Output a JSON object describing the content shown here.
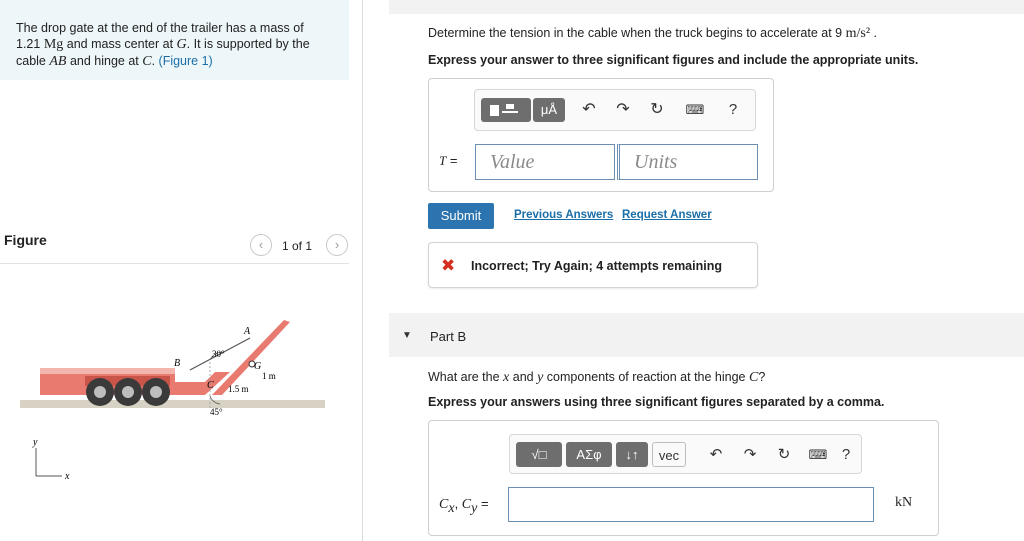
{
  "problem": {
    "text_1": "The drop gate at the end of the trailer has a mass of",
    "mass_value": "1.21",
    "mass_unit": "Mg",
    "text_2": " and mass center at ",
    "point_g": "G",
    "text_3": ". It is supported by the",
    "text_4": "cable ",
    "cable": "AB",
    "text_5": " and hinge at ",
    "point_c": "C",
    "text_6": ". ",
    "figure_link": "(Figure 1)"
  },
  "figure": {
    "heading": "Figure",
    "pager": "1 of 1",
    "prev_icon": "chevron-left-icon",
    "next_icon": "chevron-right-icon",
    "labels": {
      "a": "A",
      "b": "B",
      "c": "C",
      "g": "G",
      "angle_30": "30°",
      "angle_45": "45°",
      "len_1m": "1 m",
      "len_15m": "1.5 m",
      "axis_y": "y",
      "axis_x": "x"
    },
    "colors": {
      "trailer": "#e87a70",
      "trailer_light": "#f2b6ae",
      "ground": "#d8d2c4",
      "wheel": "#3a3a3a"
    }
  },
  "part_a": {
    "question_prefix": "Determine the tension in the cable when the truck begins to accelerate at 9 ",
    "accel_unit": "m/s²",
    "question_suffix": " .",
    "instruction": "Express your answer to three significant figures and include the appropriate units.",
    "toolbar": {
      "templates_icon": "templates-icon",
      "units_label": "μÅ",
      "undo_icon": "undo-icon",
      "redo_icon": "redo-icon",
      "reset_icon": "reset-icon",
      "keyboard_icon": "keyboard-icon",
      "help_label": "?"
    },
    "eq_label": "T",
    "eq_sign": " =",
    "value_placeholder": "Value",
    "units_placeholder": "Units",
    "submit_label": "Submit",
    "previous_answers": "Previous Answers",
    "request_answer": "Request Answer",
    "feedback_icon": "✖",
    "feedback": "Incorrect; Try Again; 4 attempts remaining",
    "feedback_color": "#d62e1f"
  },
  "part_b": {
    "caret": "▼",
    "title": "Part B",
    "question_1": "What are the ",
    "var_x": "x",
    "question_2": " and ",
    "var_y": "y",
    "question_3": " components of reaction at the hinge ",
    "hinge": "C",
    "question_4": "?",
    "instruction": "Express your answers using three significant figures separated by a comma.",
    "toolbar": {
      "matrix_label": "√□",
      "greek_label": "ΑΣφ",
      "arrows_label": "↓↑",
      "vec_label": "vec",
      "undo_icon": "undo-icon",
      "redo_icon": "redo-icon",
      "reset_icon": "reset-icon",
      "keyboard_icon": "keyboard-icon",
      "help_label": "?"
    },
    "eq_cx": "C",
    "eq_cx_sub": "x",
    "eq_sep": ", ",
    "eq_cy": "C",
    "eq_cy_sub": "y",
    "eq_sign": " =",
    "unit": "kN"
  },
  "theme": {
    "accent": "#2b74b0",
    "link": "#1a6ea8",
    "problem_bg": "#edf6f8"
  }
}
